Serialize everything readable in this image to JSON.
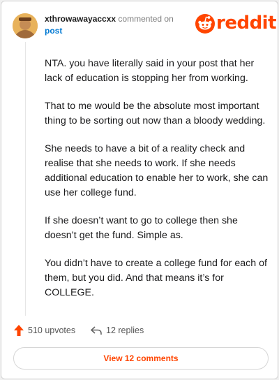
{
  "comment": {
    "username": "xthrowawayaccxx",
    "action_text": "commented on",
    "target": "post",
    "paragraphs": [
      "NTA. you have literally said in your post that her lack of education is stopping her from working.",
      "That to me would be the absolute most important thing to be sorting out now than a bloody wedding.",
      "She needs to have a bit of a reality check and realise that she needs to work. If she needs additional education to enable her to work, she can use her college fund.",
      "If she doesn’t want to go to college then she doesn’t get the fund. Simple as.",
      "You didn’t have to create a college fund for each of them, but you did. And that means it’s for COLLEGE."
    ]
  },
  "brand": {
    "name": "reddit",
    "color": "#ff4500"
  },
  "actions": {
    "upvotes_label": "510 upvotes",
    "replies_label": "12 replies",
    "view_comments_label": "View 12 comments"
  },
  "icons": {
    "upvote": "upvote-arrow-icon",
    "reply": "reply-arrow-icon",
    "logo": "reddit-snoo-icon"
  }
}
